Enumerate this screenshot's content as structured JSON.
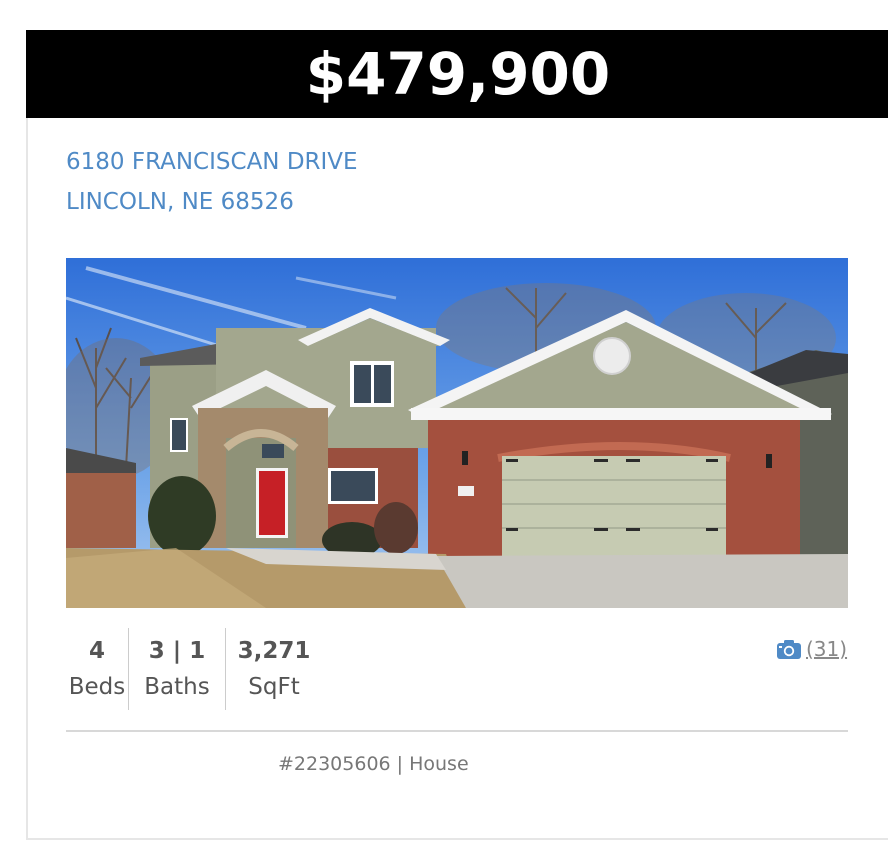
{
  "listing": {
    "price": "$479,900",
    "address_line1": "6180 FRANCISCAN DRIVE",
    "address_line2": "LINCOLN, NE 68526",
    "photo": {
      "description_icon": "house-photo",
      "alt": ""
    },
    "stats": {
      "beds_value": "4",
      "beds_label": "Beds",
      "baths_value": "3 | 1",
      "baths_label": "Baths",
      "sqft_value": "3,271",
      "sqft_label": "SqFt"
    },
    "photo_count": "(31)",
    "photo_count_icon": "camera-icon",
    "mls_line": "#22305606 | House"
  },
  "colors": {
    "price_bar": "#000000",
    "price_text": "#ffffff",
    "address_link": "#4f8ac6",
    "camera_icon": "#4f8ac6",
    "stat_text": "#555555",
    "meta_text": "#777777"
  }
}
